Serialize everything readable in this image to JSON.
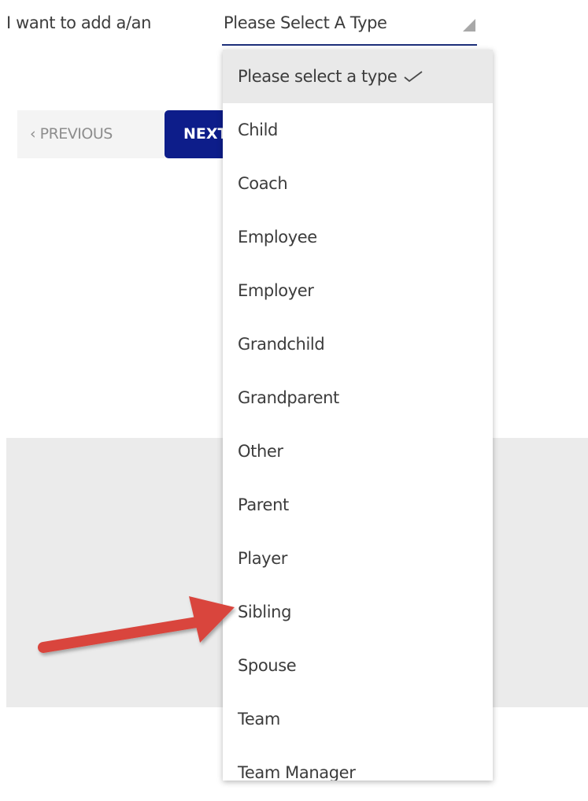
{
  "form": {
    "prompt_label": "I want to add a/an",
    "select_value": "Please Select A Type",
    "icons": {
      "select_arrow": "triangle-corner-icon",
      "check": "checkmark-icon",
      "annotation": "red-arrow-icon"
    }
  },
  "navigation": {
    "previous_label": "‹ PREVIOUS",
    "next_label": "NEXT"
  },
  "dropdown": {
    "selected_option": "Please select a type",
    "options": [
      "Please select a type",
      "Child",
      "Coach",
      "Employee",
      "Employer",
      "Grandchild",
      "Grandparent",
      "Other",
      "Parent",
      "Player",
      "Sibling",
      "Spouse",
      "Team",
      "Team Manager"
    ]
  },
  "colors": {
    "accent_navy": "#0d1d8a",
    "underline": "#1d2f7a",
    "annotation_red": "#d9453c"
  }
}
